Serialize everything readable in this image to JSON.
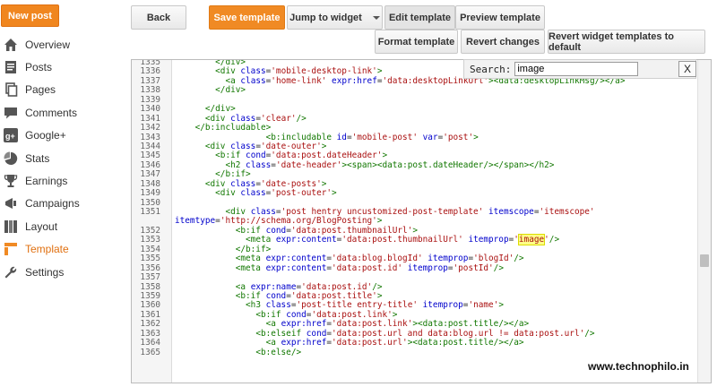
{
  "sidebar": {
    "new_post": "New post",
    "items": [
      {
        "label": "Overview",
        "icon": "home-icon"
      },
      {
        "label": "Posts",
        "icon": "posts-icon"
      },
      {
        "label": "Pages",
        "icon": "pages-icon"
      },
      {
        "label": "Comments",
        "icon": "comment-icon"
      },
      {
        "label": "Google+",
        "icon": "google-plus-icon"
      },
      {
        "label": "Stats",
        "icon": "stats-icon"
      },
      {
        "label": "Earnings",
        "icon": "trophy-icon"
      },
      {
        "label": "Campaigns",
        "icon": "campaigns-icon"
      },
      {
        "label": "Layout",
        "icon": "layout-icon"
      },
      {
        "label": "Template",
        "icon": "template-icon",
        "active": true
      },
      {
        "label": "Settings",
        "icon": "wrench-icon"
      }
    ]
  },
  "toolbar": {
    "back": "Back",
    "save": "Save template",
    "jump": "Jump to widget",
    "edit": "Edit template",
    "preview": "Preview template",
    "format": "Format template",
    "revert": "Revert changes",
    "revert_widgets": "Revert widget templates to default"
  },
  "search": {
    "label": "Search:",
    "value": "image",
    "close": "X"
  },
  "editor": {
    "lines": [
      {
        "n": "1335",
        "t": "        </div>"
      },
      {
        "n": "1336",
        "t": "        <div class='mobile-desktop-link'>"
      },
      {
        "n": "1337",
        "t": "          <a class='home-link' expr:href='data:desktopLinkUrl'><data:desktopLinkMsg/></a>"
      },
      {
        "n": "1338",
        "t": "        </div>"
      },
      {
        "n": "1339",
        "t": ""
      },
      {
        "n": "1340",
        "t": "      </div>"
      },
      {
        "n": "1341",
        "t": "      <div class='clear'/>"
      },
      {
        "n": "1342",
        "t": "    </b:includable>"
      },
      {
        "n": "1343",
        "t": "                  <b:includable id='mobile-post' var='post'>"
      },
      {
        "n": "1344",
        "t": "      <div class='date-outer'>"
      },
      {
        "n": "1345",
        "t": "        <b:if cond='data:post.dateHeader'>"
      },
      {
        "n": "1346",
        "t": "          <h2 class='date-header'><span><data:post.dateHeader/></span></h2>"
      },
      {
        "n": "1347",
        "t": "        </b:if>"
      },
      {
        "n": "1348",
        "t": "      <div class='date-posts'>"
      },
      {
        "n": "1349",
        "t": "        <div class='post-outer'>"
      },
      {
        "n": "1350",
        "t": ""
      },
      {
        "n": "1351",
        "t": "          <div class='post hentry uncustomized-post-template' itemscope='itemscope'"
      },
      {
        "n": "",
        "t": "itemtype='http://schema.org/BlogPosting'>"
      },
      {
        "n": "1352",
        "t": "            <b:if cond='data:post.thumbnailUrl'>"
      },
      {
        "n": "1353",
        "t": "              <meta expr:content='data:post.thumbnailUrl' itemprop='image'/>"
      },
      {
        "n": "1354",
        "t": "            </b:if>"
      },
      {
        "n": "1355",
        "t": "            <meta expr:content='data:blog.blogId' itemprop='blogId'/>"
      },
      {
        "n": "1356",
        "t": "            <meta expr:content='data:post.id' itemprop='postId'/>"
      },
      {
        "n": "1357",
        "t": ""
      },
      {
        "n": "1358",
        "t": "            <a expr:name='data:post.id'/>"
      },
      {
        "n": "1359",
        "t": "            <b:if cond='data:post.title'>"
      },
      {
        "n": "1360",
        "t": "              <h3 class='post-title entry-title' itemprop='name'>"
      },
      {
        "n": "1361",
        "t": "                <b:if cond='data:post.link'>"
      },
      {
        "n": "1362",
        "t": "                  <a expr:href='data:post.link'><data:post.title/></a>"
      },
      {
        "n": "1363",
        "t": "                <b:elseif cond='data:post.url and data:blog.url != data:post.url'/>"
      },
      {
        "n": "1364",
        "t": "                  <a expr:href='data:post.url'><data:post.title/></a>"
      },
      {
        "n": "1365",
        "t": "                <b:else/>"
      }
    ]
  },
  "watermark": "www.technophilo.in",
  "colors": {
    "accent": "#f08a24",
    "tag": "#117700",
    "attr": "#0000cc",
    "value": "#aa1111"
  }
}
